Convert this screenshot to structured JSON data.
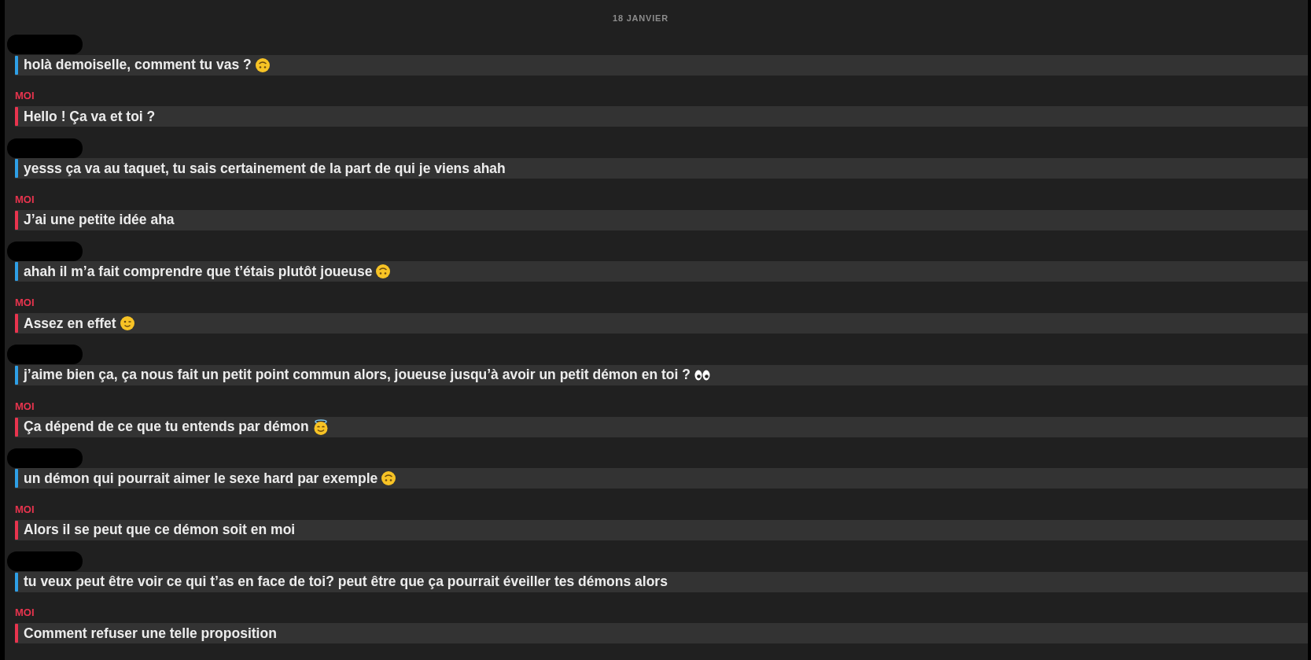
{
  "date_header": "18 JANVIER",
  "messages": [
    {
      "kind": "incoming",
      "sender_redacted": true,
      "text": "holà demoiselle, comment tu vas ?",
      "emoji": {
        "kind": "upside_down"
      }
    },
    {
      "kind": "outgoing",
      "sender": "MOI",
      "text": "Hello ! Ça va et toi ?"
    },
    {
      "kind": "incoming",
      "sender_redacted": true,
      "text": "yesss ça va au taquet, tu sais certainement de la part de qui je viens ahah"
    },
    {
      "kind": "outgoing",
      "sender": "MOI",
      "text": "J’ai une petite idée aha"
    },
    {
      "kind": "incoming",
      "sender_redacted": true,
      "text": "ahah il m’a fait comprendre que t’étais plutôt joueuse",
      "emoji": {
        "kind": "upside_down"
      }
    },
    {
      "kind": "outgoing",
      "sender": "MOI",
      "text": "Assez en effet",
      "emoji": {
        "kind": "wink"
      }
    },
    {
      "kind": "incoming",
      "sender_redacted": true,
      "text": "j’aime bien ça, ça nous fait un petit point commun alors, joueuse jusqu’à avoir un petit démon en toi ?",
      "emoji": {
        "kind": "eyes"
      }
    },
    {
      "kind": "outgoing",
      "sender": "MOI",
      "text": "Ça dépend de ce que tu entends par démon",
      "emoji": {
        "kind": "halo"
      }
    },
    {
      "kind": "incoming",
      "sender_redacted": true,
      "text": "un démon qui pourrait aimer le sexe hard par exemple",
      "emoji": {
        "kind": "upside_down"
      }
    },
    {
      "kind": "outgoing",
      "sender": "MOI",
      "text": "Alors il se peut que ce démon soit en moi"
    },
    {
      "kind": "incoming",
      "sender_redacted": true,
      "text": "tu veux peut être voir ce qui t’as en face de toi? peut être que ça pourrait éveiller tes démons alors"
    },
    {
      "kind": "outgoing",
      "sender": "MOI",
      "text": "Comment refuser une telle proposition"
    }
  ]
}
